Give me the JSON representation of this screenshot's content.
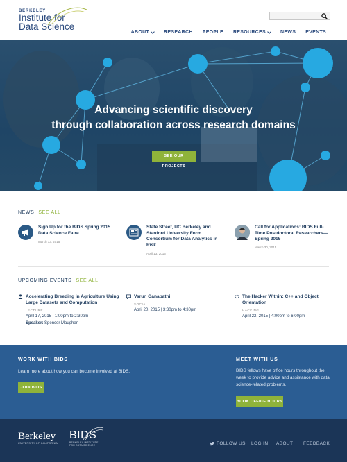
{
  "header": {
    "logo_small": "BERKELEY",
    "logo_line1": "Institute for",
    "logo_line2": "Data Science",
    "nav": [
      "ABOUT",
      "RESEARCH",
      "PEOPLE",
      "RESOURCES",
      "NEWS",
      "EVENTS"
    ]
  },
  "search": {
    "placeholder": ""
  },
  "hero": {
    "line1": "Advancing scientific discovery",
    "line2": "through collaboration across research domains",
    "button": "SEE OUR PROJECTS"
  },
  "news": {
    "heading": "NEWS",
    "see_all": "SEE ALL",
    "items": [
      {
        "title": "Sign Up for the BIDS Spring 2015 Data Science Faire",
        "date": "March 13, 2015",
        "icon": "megaphone-icon"
      },
      {
        "title": "State Street, UC Berkeley and Stanford University Form Consortium for Data Analytics in Risk",
        "date": "April 13, 2015",
        "icon": "newspaper-icon"
      },
      {
        "title": "Call for Applications: BIDS Full-Time Postdoctoral Researchers—Spring 2015",
        "date": "March 30, 2015",
        "icon": "avatar-photo"
      }
    ]
  },
  "events": {
    "heading": "UPCOMING EVENTS",
    "see_all": "SEE ALL",
    "items": [
      {
        "title": "Accelerating Breeding in Agriculture Using Large Datasets and Computation",
        "type": "LECTURE",
        "when": "April 17, 2015 | 1:00pm to 2:30pm",
        "speaker_label": "Speaker:",
        "speaker": "Spencer Maughan",
        "icon": "person-icon"
      },
      {
        "title": "Varun Ganapathi",
        "type": "SOCIAL",
        "when": "April 20, 2015 | 3:30pm to 4:30pm",
        "icon": "chat-icon"
      },
      {
        "title": "The Hacker Within: C++ and Object Orientation",
        "type": "HACKING",
        "when": "April 22, 2015 | 4:00pm to 6:00pm",
        "icon": "code-icon"
      }
    ]
  },
  "work": {
    "title": "WORK WITH BIDS",
    "text": "Learn more about how you can become involved at BIDS.",
    "button": "JOIN BIDS"
  },
  "meet": {
    "title": "MEET WITH US",
    "text_l1": "BIDS fellows have office hours throughout the",
    "text_l2": "week to provide advice and assistance with data",
    "text_l3": "science-related problems.",
    "button": "BOOK OFFICE HOURS"
  },
  "footer": {
    "berkeley": "Berkeley",
    "berkeley_sub": "UNIVERSITY OF CALIFORNIA",
    "bids": "BIDS",
    "bids_sub1": "BERKELEY INSTITUTE",
    "bids_sub2": "FOR DATA SCIENCE",
    "links": [
      "FOLLOW US",
      "LOG IN",
      "ABOUT",
      "FEEDBACK"
    ]
  },
  "colors": {
    "navy": "#1d3a5c",
    "accent_green": "#8fb33a",
    "band_blue": "#2b5d93",
    "footer_navy": "#1b3557",
    "bubble": "#27a9e1"
  }
}
